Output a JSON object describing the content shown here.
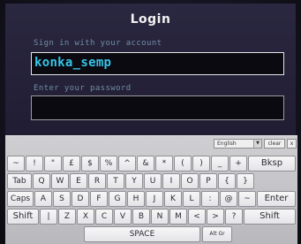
{
  "login": {
    "title": "Login",
    "username_hint": "Sign in with your account",
    "username_value": "konka_semp",
    "password_hint": "Enter your password",
    "password_value": ""
  },
  "keyboard": {
    "language": "English",
    "clear_label": "clear",
    "close_label": "x",
    "rows": [
      [
        "~",
        "!",
        "\"",
        "£",
        "$",
        "%",
        "^",
        "&",
        "*",
        "(",
        ")",
        "_",
        "+",
        "Bksp"
      ],
      [
        "Tab",
        "Q",
        "W",
        "E",
        "R",
        "T",
        "Y",
        "U",
        "I",
        "O",
        "P",
        "{",
        "}"
      ],
      [
        "Caps",
        "A",
        "S",
        "D",
        "F",
        "G",
        "H",
        "J",
        "K",
        "L",
        ":",
        "@",
        "~",
        "Enter"
      ],
      [
        "Shift",
        "|",
        "Z",
        "X",
        "C",
        "V",
        "B",
        "N",
        "M",
        "<",
        ">",
        "?",
        "Shift"
      ],
      [
        "SPACE",
        "Alt Gr"
      ]
    ]
  }
}
